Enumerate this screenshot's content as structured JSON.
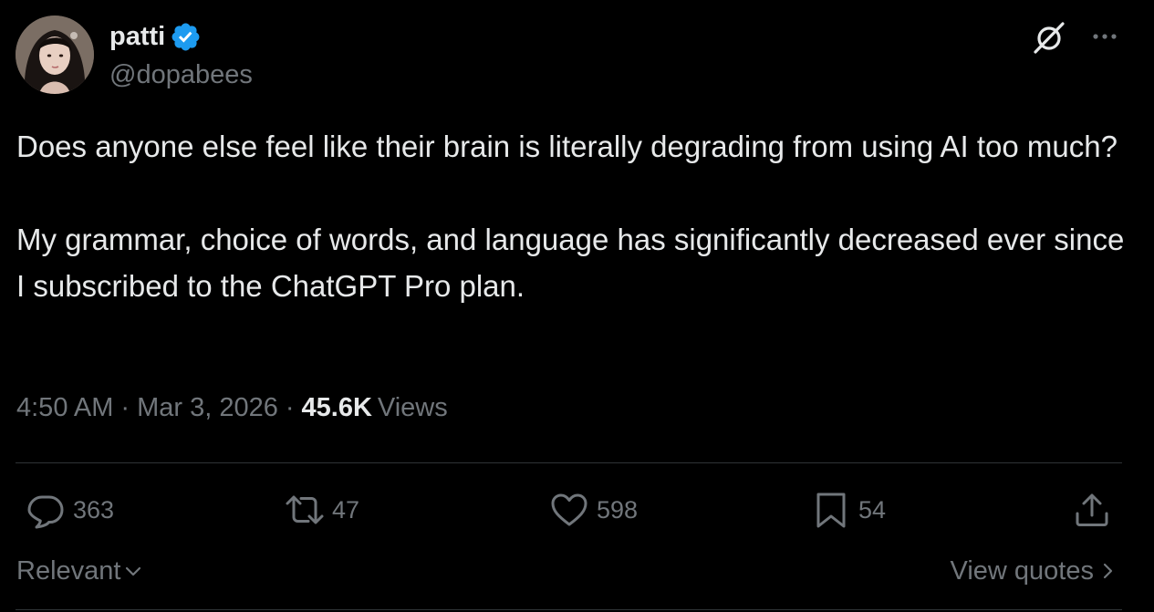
{
  "author": {
    "display_name": "patti",
    "handle": "@dopabees",
    "verified": true
  },
  "header_actions": {
    "grok_icon": "grok-icon",
    "more_icon": "more-dots-icon"
  },
  "tweet": {
    "paragraphs": [
      "Does anyone else feel like their brain is literally degrading from using AI too much?",
      "My grammar, choice of words, and language has significantly decreased ever since I subscribed to the ChatGPT Pro plan."
    ],
    "time": "4:50 AM",
    "date": "Mar 3, 2026",
    "separator": "·",
    "views_count": "45.6K",
    "views_label": "Views"
  },
  "actions": {
    "replies": "363",
    "reposts": "47",
    "likes": "598",
    "bookmarks": "54"
  },
  "footer": {
    "sort_label": "Relevant",
    "view_quotes_label": "View quotes"
  },
  "colors": {
    "background": "#000000",
    "text_primary": "#e7e9ea",
    "text_secondary": "#71767b",
    "verified_blue": "#1d9bf0",
    "divider": "#2f3336"
  }
}
